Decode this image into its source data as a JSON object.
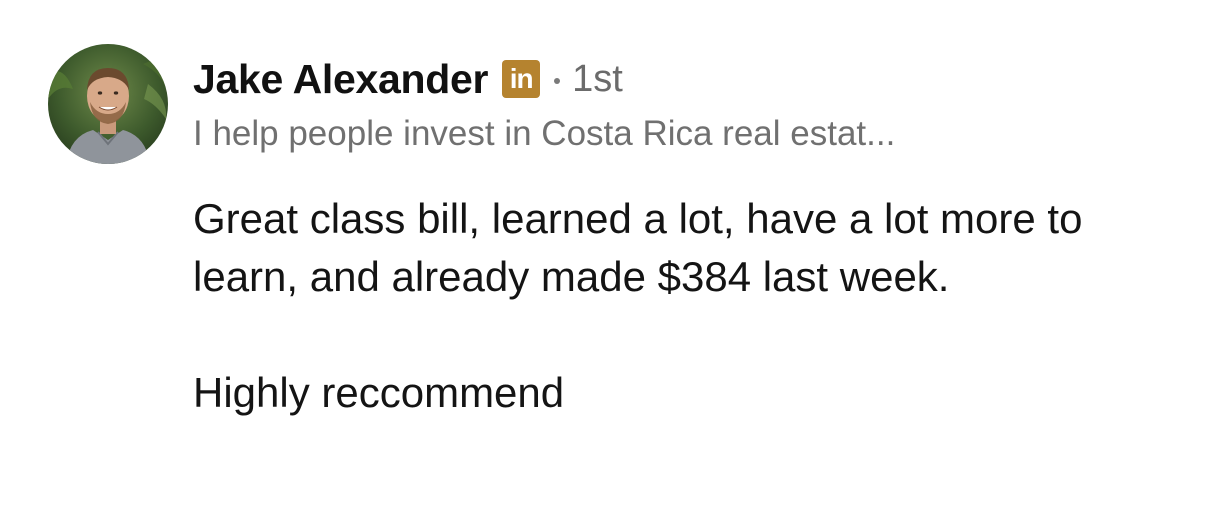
{
  "comment": {
    "author": {
      "name": "Jake Alexander",
      "badge": "in",
      "degree": "1st",
      "headline": "I help people invest in Costa Rica real estat..."
    },
    "body": {
      "paragraph_1": "Great class bill, learned a lot, have a lot more to learn, and already made $384 last week.",
      "paragraph_2": "Highly reccommend"
    }
  },
  "colors": {
    "badge_bg": "#b5832f",
    "name": "#111111",
    "meta": "#6b6b6b"
  },
  "icons": {
    "avatar": "profile-photo",
    "badge": "linkedin-icon"
  }
}
